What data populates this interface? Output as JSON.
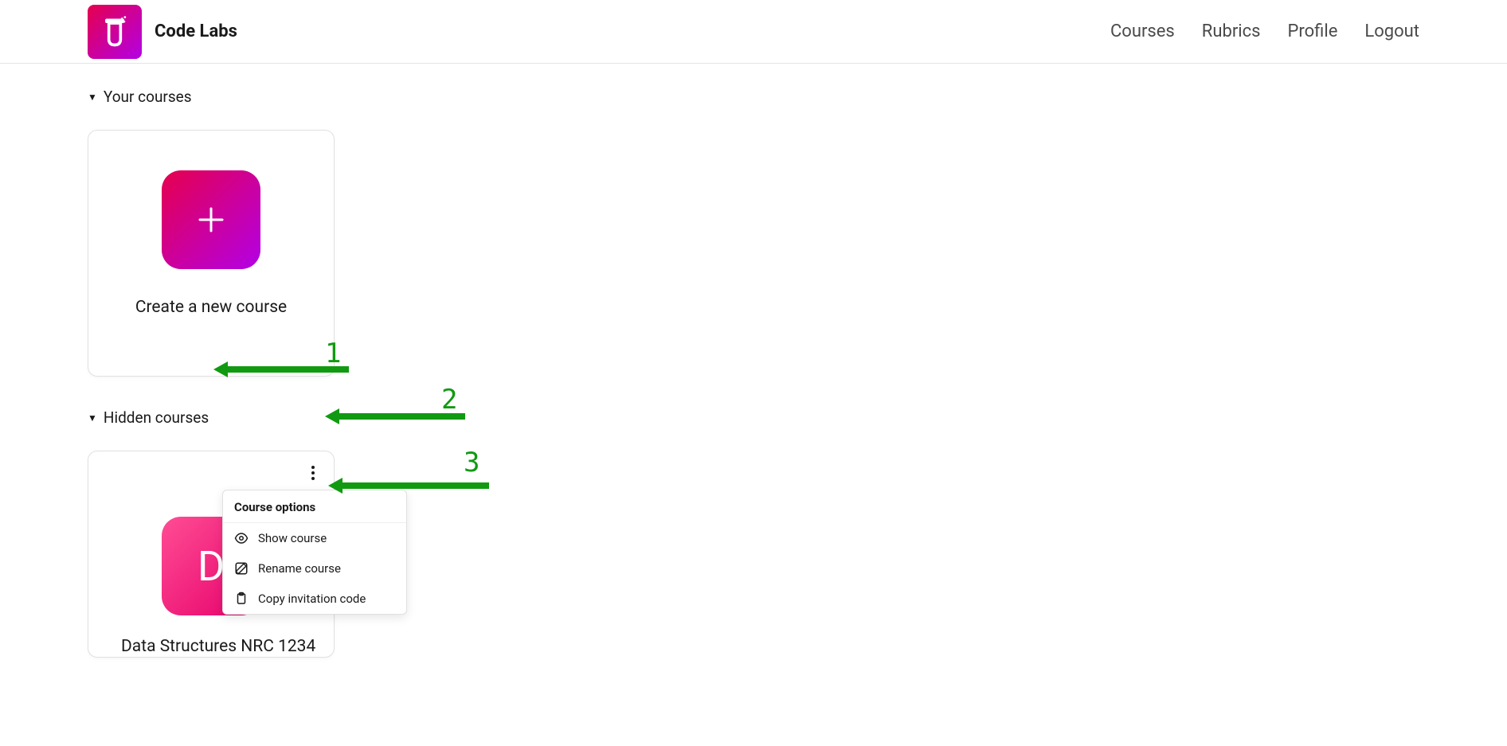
{
  "brand": {
    "name": "Code Labs"
  },
  "nav": {
    "courses": "Courses",
    "rubrics": "Rubrics",
    "profile": "Profile",
    "logout": "Logout"
  },
  "sections": {
    "your_courses": "Your courses",
    "hidden_courses": "Hidden courses"
  },
  "create_card": {
    "title": "Create a new course"
  },
  "hidden_course": {
    "initial": "D",
    "title": "Data Structures NRC 1234"
  },
  "dropdown": {
    "header": "Course options",
    "show": "Show course",
    "rename": "Rename course",
    "copy": "Copy invitation code"
  },
  "annotations": {
    "n1": "1",
    "n2": "2",
    "n3": "3"
  }
}
